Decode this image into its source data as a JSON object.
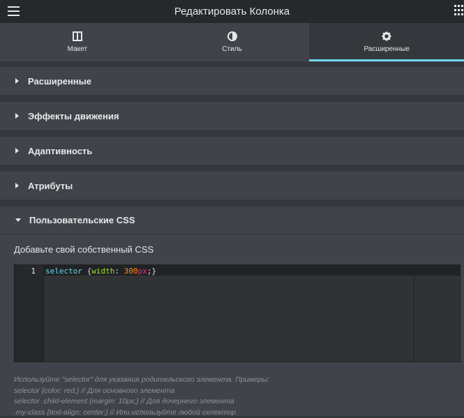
{
  "header": {
    "title": "Редактировать Колонка",
    "menu_icon": "hamburger-icon",
    "apps_icon": "grid-icon"
  },
  "tabs": [
    {
      "label": "Макет",
      "icon": "layout-icon",
      "active": false
    },
    {
      "label": "Стиль",
      "icon": "contrast-icon",
      "active": false
    },
    {
      "label": "Расширенные",
      "icon": "gear-icon",
      "active": true
    }
  ],
  "sections": [
    {
      "label": "Расширенные",
      "open": false
    },
    {
      "label": "Эффекты движения",
      "open": false
    },
    {
      "label": "Адаптивность",
      "open": false
    },
    {
      "label": "Атрибуты",
      "open": false
    },
    {
      "label": "Пользовательские CSS",
      "open": true
    }
  ],
  "custom_css": {
    "label": "Добавьте свой собственный CSS",
    "line_number": "1",
    "code": {
      "selector": "selector",
      "brace_open": " {",
      "property": "width",
      "colon": ": ",
      "number": "300",
      "unit": "px",
      "end": ";}"
    },
    "help": [
      "Используйте \"selector\" для указания родительского элемента. Примеры:",
      "selector {color: red;} // Для основного элемента",
      "selector .child-element {margin: 10px;} // Для дочернего элемента",
      ".my-class {text-align: center;} // Или используйте любой селектор"
    ]
  },
  "colors": {
    "accent": "#71d7f7",
    "panel": "#404349",
    "background": "#34383c",
    "header": "#26292c"
  }
}
